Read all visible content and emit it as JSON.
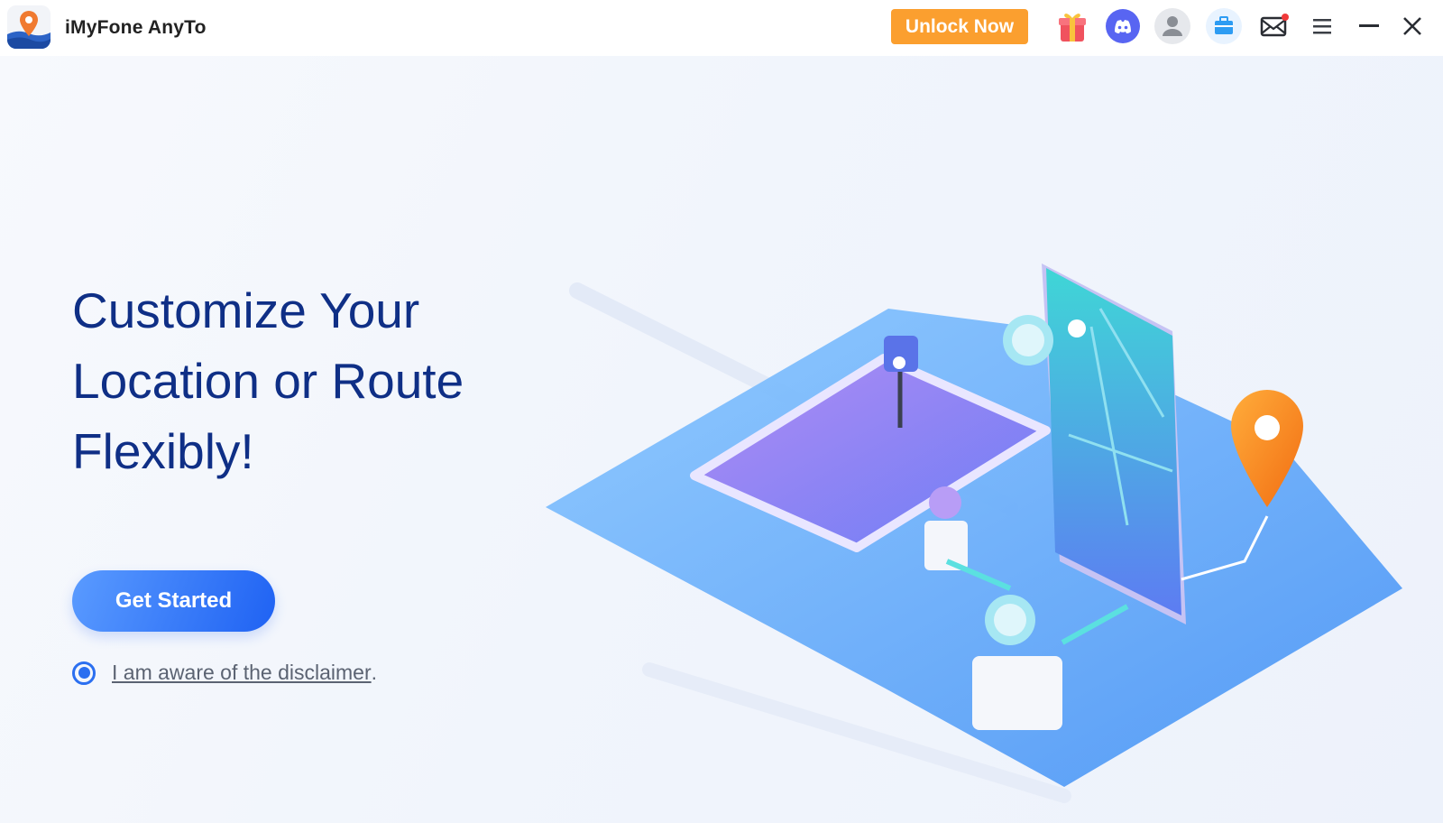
{
  "app": {
    "title": "iMyFone AnyTo"
  },
  "titlebar": {
    "unlock_label": "Unlock Now",
    "unlock_color": "#fb9f2f",
    "icons": [
      "gift-icon",
      "discord-icon",
      "user-avatar-icon",
      "toolbox-icon",
      "mail-icon",
      "menu-icon",
      "minimize-icon",
      "close-icon"
    ]
  },
  "main": {
    "headline_line1": "Customize Your",
    "headline_line2": "Location or Route",
    "headline_line3": "Flexibly!",
    "cta_label": "Get Started",
    "disclaimer_text": "I am aware of the disclaimer",
    "disclaimer_period": ".",
    "disclaimer_checked": true,
    "accent": "#2b6ff0"
  }
}
